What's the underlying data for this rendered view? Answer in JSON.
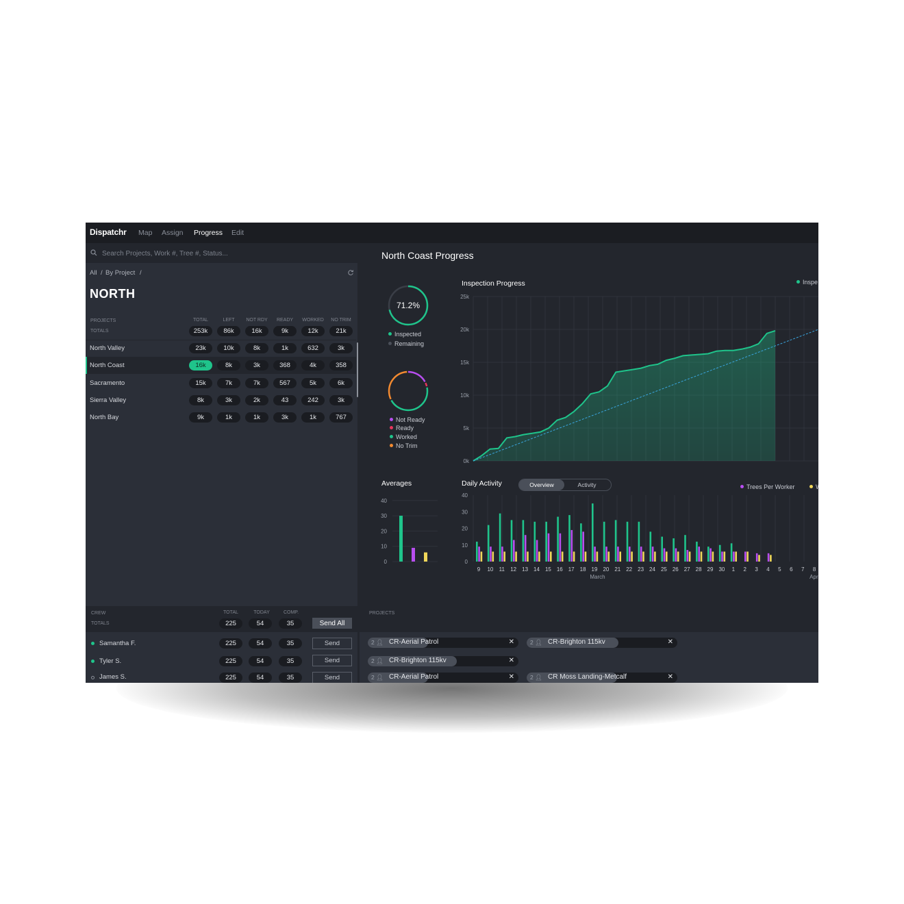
{
  "app": {
    "brand": "Dispatchr",
    "nav": [
      "Map",
      "Assign",
      "Progress",
      "Edit"
    ],
    "active_nav": "Progress"
  },
  "search": {
    "placeholder": "Search Projects, Work #, Tree #, Status..."
  },
  "breadcrumb": [
    "All",
    "/",
    "By Project",
    "/"
  ],
  "region": "NORTH",
  "projects_table": {
    "label_projects": "PROJECTS",
    "label_totals": "TOTALS",
    "columns": [
      "TOTAL",
      "LEFT",
      "NOT RDY",
      "READY",
      "WORKED",
      "NO TRIM"
    ],
    "totals": [
      "253k",
      "86k",
      "16k",
      "9k",
      "12k",
      "21k"
    ],
    "rows": [
      {
        "name": "North Valley",
        "values": [
          "23k",
          "10k",
          "8k",
          "1k",
          "632",
          "3k"
        ]
      },
      {
        "name": "North Coast",
        "values": [
          "16k",
          "8k",
          "3k",
          "368",
          "4k",
          "358"
        ],
        "selected": true
      },
      {
        "name": "Sacramento",
        "values": [
          "15k",
          "7k",
          "7k",
          "567",
          "5k",
          "6k"
        ]
      },
      {
        "name": "Sierra Valley",
        "values": [
          "8k",
          "3k",
          "2k",
          "43",
          "242",
          "3k"
        ]
      },
      {
        "name": "North Bay",
        "values": [
          "9k",
          "1k",
          "1k",
          "3k",
          "1k",
          "767"
        ]
      }
    ]
  },
  "main": {
    "title": "North Coast Progress"
  },
  "donut1": {
    "percent_label": "71.2%",
    "value": 0.712,
    "legend": [
      {
        "label": "Inspected",
        "color": "#1fc48b"
      },
      {
        "label": "Remaining",
        "color": "#4a4f59"
      }
    ]
  },
  "donut2": {
    "legend": [
      {
        "label": "Not Ready",
        "color": "#b84ef0"
      },
      {
        "label": "Ready",
        "color": "#e8365d"
      },
      {
        "label": "Worked",
        "color": "#1fc48b"
      },
      {
        "label": "No Trim",
        "color": "#f28a30"
      }
    ],
    "segments": [
      0.18,
      0.04,
      0.46,
      0.32
    ]
  },
  "inspection": {
    "title": "Inspection Progress",
    "legend_label": "Inspe"
  },
  "averages": {
    "title": "Averages"
  },
  "daily": {
    "title": "Daily Activity",
    "tabs": [
      "Overview",
      "Activity"
    ],
    "active_tab": "Overview",
    "legend": [
      "Trees Per Worker",
      "W"
    ]
  },
  "chart_data": [
    {
      "type": "line",
      "title": "Inspection Progress",
      "ylim": [
        0,
        25000
      ],
      "yticks": [
        "0k",
        "5k",
        "10k",
        "15k",
        "20k",
        "25k"
      ],
      "series": [
        {
          "name": "Inspe",
          "values": [
            0,
            800,
            1800,
            1900,
            3500,
            3700,
            4000,
            4200,
            4400,
            5000,
            6200,
            6600,
            7500,
            8700,
            10200,
            10500,
            11400,
            13500,
            13700,
            13900,
            14100,
            14500,
            14700,
            15300,
            15600,
            16000,
            16100,
            16200,
            16300,
            16700,
            16800,
            16800,
            17000,
            17300,
            17800,
            19400,
            19800
          ]
        },
        {
          "values": [
            0,
            20000
          ]
        }
      ]
    },
    {
      "type": "bar",
      "title": "Averages",
      "ylim": [
        0,
        40
      ],
      "yticks": [
        "0",
        "10",
        "20",
        "30",
        "40"
      ],
      "values": [
        30,
        9,
        6
      ],
      "colors": [
        "#1fc48b",
        "#b84ef0",
        "#f0d75a"
      ]
    },
    {
      "type": "bar",
      "title": "Daily Activity",
      "ylim": [
        0,
        40
      ],
      "yticks": [
        "0",
        "10",
        "20",
        "30",
        "40"
      ],
      "categories": [
        "9",
        "10",
        "11",
        "12",
        "13",
        "14",
        "15",
        "16",
        "17",
        "18",
        "19",
        "20",
        "21",
        "22",
        "23",
        "24",
        "25",
        "26",
        "27",
        "28",
        "29",
        "30",
        "1",
        "2",
        "3",
        "4",
        "5",
        "6",
        "7",
        "8"
      ],
      "month_labels": [
        "March",
        "April"
      ],
      "series": [
        {
          "name": "green",
          "values": [
            12,
            22,
            29,
            25,
            25,
            24,
            24,
            27,
            28,
            23,
            35,
            24,
            25,
            24,
            24,
            18,
            15,
            14,
            16,
            12,
            9,
            10,
            11,
            0,
            0,
            0,
            0,
            0,
            0,
            0
          ]
        },
        {
          "name": "Trees Per Worker",
          "values": [
            9,
            9,
            9,
            13,
            16,
            13,
            17,
            17,
            19,
            18,
            9,
            9,
            9,
            9,
            9,
            9,
            8,
            8,
            7,
            9,
            8,
            6,
            6,
            6,
            5,
            5,
            0,
            0,
            0,
            0
          ]
        },
        {
          "name": "W",
          "values": [
            6,
            6,
            6,
            6,
            6,
            6,
            6,
            6,
            6,
            6,
            6,
            6,
            6,
            6,
            6,
            6,
            6,
            6,
            6,
            6,
            6,
            6,
            6,
            6,
            4,
            4,
            0,
            0,
            0,
            0
          ]
        }
      ],
      "extra_short_bars": true
    }
  ],
  "crew": {
    "label_crew": "CREW",
    "label_totals": "TOTALS",
    "columns": [
      "TOTAL",
      "TODAY",
      "COMP."
    ],
    "totals": [
      "225",
      "54",
      "35"
    ],
    "send_all_label": "Send All",
    "rows": [
      {
        "name": "Samantha F.",
        "values": [
          "225",
          "54",
          "35"
        ],
        "send_label": "Send",
        "status": "online"
      },
      {
        "name": "Tyler S.",
        "values": [
          "225",
          "54",
          "35"
        ],
        "send_label": "Send",
        "status": "online"
      },
      {
        "name": "James S.",
        "values": [
          "225",
          "54",
          "35"
        ],
        "send_label": "Send",
        "status": "offline"
      }
    ]
  },
  "assigned_projects": {
    "label": "PROJECTS",
    "chips": [
      {
        "count": "2",
        "name": "CR-Aerial Patrol",
        "fill": 0.4
      },
      {
        "count": "2",
        "name": "CR-Brighton 115kv",
        "fill": 0.61
      },
      {
        "count": "2",
        "name": "CR-Brighton 115kv",
        "fill": 0.59
      },
      {
        "count": "2",
        "name": "CR-Aerial Patrol",
        "fill": 0.4
      },
      {
        "count": "2",
        "name": "CR Moss Landing-Metcalf",
        "fill": 0.6
      }
    ]
  },
  "colors": {
    "accent": "#1fc48b",
    "purple": "#b84ef0",
    "yellow": "#f0d75a",
    "orange": "#f28a30",
    "red": "#e8365d",
    "bg": "#23262d",
    "panel": "#2b2f38"
  }
}
